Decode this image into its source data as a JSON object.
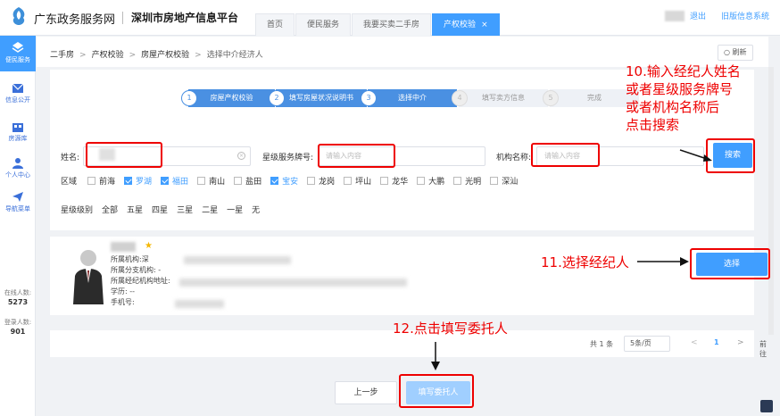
{
  "header": {
    "brand": "广东政务服务网",
    "platform": "深圳市房地产信息平台",
    "tabs": [
      {
        "label": "首页"
      },
      {
        "label": "便民服务"
      },
      {
        "label": "我要买卖二手房"
      },
      {
        "label": "产权校验",
        "close": "×"
      }
    ],
    "logout": "退出",
    "old_version": "旧版信息系统"
  },
  "sidebar": {
    "items": [
      {
        "label": "便民服务",
        "icon": "grid-icon"
      },
      {
        "label": "信息公开",
        "icon": "mail-icon"
      },
      {
        "label": "房源库",
        "icon": "building-icon"
      },
      {
        "label": "个人中心",
        "icon": "user-icon"
      },
      {
        "label": "导航菜单",
        "icon": "send-icon"
      }
    ],
    "online_label": "在线人数:",
    "online_count": "5273",
    "login_label": "登录人数:",
    "login_count": "901"
  },
  "breadcrumb": {
    "items": [
      "二手房",
      "产权校验",
      "房屋产权校验",
      "选择中介经济人"
    ],
    "separator": ">",
    "refresh": "刷新"
  },
  "steps": [
    {
      "num": "1",
      "label": "房屋产权校验"
    },
    {
      "num": "2",
      "label": "填写房屋状况说明书"
    },
    {
      "num": "3",
      "label": "选择中介"
    },
    {
      "num": "4",
      "label": "填写卖方信息"
    },
    {
      "num": "5",
      "label": "完成"
    }
  ],
  "form": {
    "name_label": "姓名:",
    "star_label": "星级服务牌号:",
    "star_placeholder": "请输入内容",
    "org_label": "机构名称:",
    "org_placeholder": "请输入内容",
    "search_button": "搜索",
    "region_label": "区域",
    "regions": [
      {
        "label": "前海",
        "checked": false
      },
      {
        "label": "罗湖",
        "checked": true
      },
      {
        "label": "福田",
        "checked": true
      },
      {
        "label": "南山",
        "checked": false
      },
      {
        "label": "盐田",
        "checked": false
      },
      {
        "label": "宝安",
        "checked": true
      },
      {
        "label": "龙岗",
        "checked": false
      },
      {
        "label": "坪山",
        "checked": false
      },
      {
        "label": "龙华",
        "checked": false
      },
      {
        "label": "大鹏",
        "checked": false
      },
      {
        "label": "光明",
        "checked": false
      },
      {
        "label": "深汕",
        "checked": false
      }
    ],
    "level_label": "星级级别",
    "levels": [
      "全部",
      "五星",
      "四星",
      "三星",
      "二星",
      "一星",
      "无"
    ]
  },
  "agent": {
    "org_label": "所属机构:",
    "org_value": "深",
    "branch_label": "所属分支机构:",
    "branch_value": "-",
    "address_label": "所属经纪机构地址:",
    "edu_label": "学历:",
    "edu_value": "--",
    "phone_label": "手机号:",
    "select_button": "选择"
  },
  "pager": {
    "total": "共 1 条",
    "page_size": "5条/页",
    "prev": "<",
    "page": "1",
    "next": ">",
    "goto": "前往"
  },
  "footer": {
    "prev_button": "上一步",
    "fill_button": "填写委托人"
  },
  "annotations": {
    "a10_line1": "10.输入经纪人姓名",
    "a10_line2": "或者星级服务牌号",
    "a10_line3": "或者机构名称后",
    "a10_line4": "点击搜索",
    "a11": "11.选择经纪人",
    "a12": "12.点击填写委托人"
  },
  "colors": {
    "primary": "#409eff",
    "annotation": "#e00000",
    "disabled_button": "#a0cfff"
  }
}
